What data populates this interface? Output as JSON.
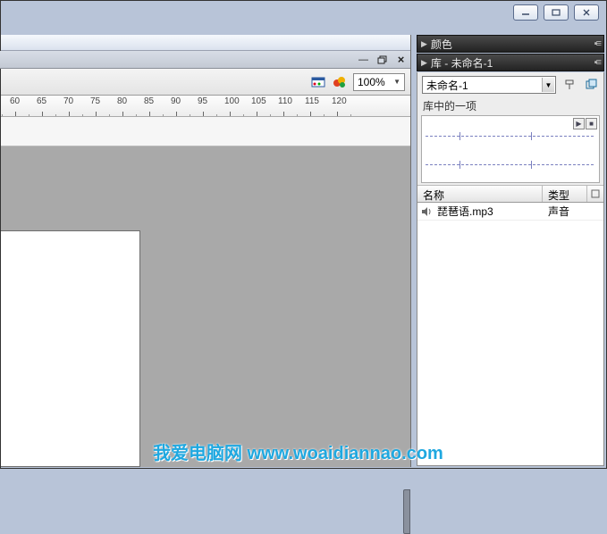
{
  "window_buttons": {
    "min": "minimize",
    "max": "maximize",
    "close": "close"
  },
  "toolbar": {
    "zoom": "100%"
  },
  "ruler": {
    "start": 55,
    "step": 5,
    "count": 14
  },
  "panels": {
    "color": {
      "title": "颜色"
    },
    "library": {
      "title": "库 - 未命名-1",
      "combo_value": "未命名-1",
      "status": "库中的一项",
      "columns": {
        "name": "名称",
        "type": "类型"
      },
      "items": [
        {
          "name": "琵琶语.mp3",
          "type": "声音"
        }
      ]
    }
  },
  "watermark": "我爱电脑网  www.woaidiannao.com"
}
